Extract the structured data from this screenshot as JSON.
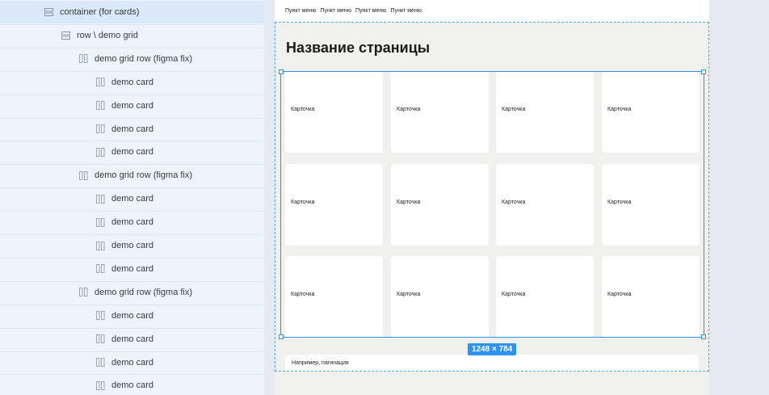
{
  "layers": [
    {
      "label": "container (for cards)",
      "icon": "frame-rows-icon",
      "indent": 0,
      "selected": true
    },
    {
      "label": "row \\ demo grid",
      "icon": "frame-rows-icon",
      "indent": 1,
      "selected": false
    },
    {
      "label": "demo grid row (figma fix)",
      "icon": "frame-columns-icon",
      "indent": 2,
      "selected": false
    },
    {
      "label": "demo card",
      "icon": "frame-columns-icon",
      "indent": 3,
      "selected": false
    },
    {
      "label": "demo card",
      "icon": "frame-columns-icon",
      "indent": 3,
      "selected": false
    },
    {
      "label": "demo card",
      "icon": "frame-columns-icon",
      "indent": 3,
      "selected": false
    },
    {
      "label": "demo card",
      "icon": "frame-columns-icon",
      "indent": 3,
      "selected": false
    },
    {
      "label": "demo grid row (figma fix)",
      "icon": "frame-columns-icon",
      "indent": 2,
      "selected": false
    },
    {
      "label": "demo card",
      "icon": "frame-columns-icon",
      "indent": 3,
      "selected": false
    },
    {
      "label": "demo card",
      "icon": "frame-columns-icon",
      "indent": 3,
      "selected": false
    },
    {
      "label": "demo card",
      "icon": "frame-columns-icon",
      "indent": 3,
      "selected": false
    },
    {
      "label": "demo card",
      "icon": "frame-columns-icon",
      "indent": 3,
      "selected": false
    },
    {
      "label": "demo grid row (figma fix)",
      "icon": "frame-columns-icon",
      "indent": 2,
      "selected": false
    },
    {
      "label": "demo card",
      "icon": "frame-columns-icon",
      "indent": 3,
      "selected": false
    },
    {
      "label": "demo card",
      "icon": "frame-columns-icon",
      "indent": 3,
      "selected": false
    },
    {
      "label": "demo card",
      "icon": "frame-columns-icon",
      "indent": 3,
      "selected": false
    },
    {
      "label": "demo card",
      "icon": "frame-columns-icon",
      "indent": 3,
      "selected": false
    }
  ],
  "nav": {
    "items": [
      "Пункт меню",
      "Пункт меню",
      "Пункт меню",
      "Пункт меню"
    ]
  },
  "page": {
    "title": "Название страницы",
    "card_label": "Карточка",
    "card_rows": 3,
    "card_columns": 4,
    "pagination_text": "Например, пагинация"
  },
  "selection": {
    "size_label": "1248 × 784"
  },
  "colors": {
    "selection_blue": "#2e93f0",
    "layers_bg": "#eef4fb",
    "selected_row_bg": "#dbe8f7"
  }
}
